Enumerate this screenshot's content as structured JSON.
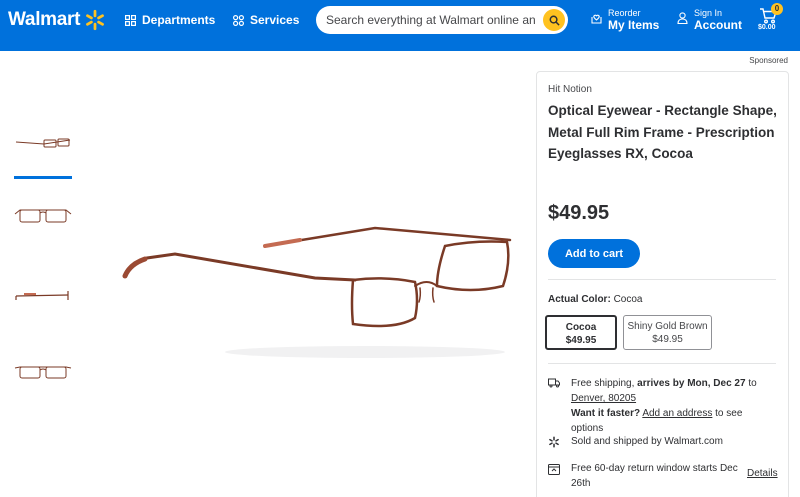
{
  "header": {
    "logo_text": "Walmart",
    "departments_label": "Departments",
    "services_label": "Services",
    "search_placeholder": "Search everything at Walmart online and in store",
    "reorder_small": "Reorder",
    "reorder_big": "My Items",
    "signin_small": "Sign In",
    "signin_big": "Account",
    "cart_count": "0",
    "cart_total": "$0.00"
  },
  "sponsored_label": "Sponsored",
  "thumbnails": [
    {
      "icon": "eyeglasses-side-view",
      "active": true
    },
    {
      "icon": "eyeglasses-front-view",
      "active": false
    },
    {
      "icon": "eyeglasses-temple-view",
      "active": false
    },
    {
      "icon": "eyeglasses-front-flat-view",
      "active": false
    }
  ],
  "product": {
    "brand": "Hit Notion",
    "title": "Optical Eyewear - Rectangle Shape, Metal Full Rim Frame - Prescription Eyeglasses RX, Cocoa",
    "price": "$49.95",
    "add_to_cart": "Add to cart",
    "actual_color_label": "Actual Color:",
    "actual_color_value": "Cocoa",
    "variants": [
      {
        "name": "Cocoa",
        "price": "$49.95",
        "selected": true
      },
      {
        "name": "Shiny Gold Brown",
        "price": "$49.95",
        "selected": false
      }
    ]
  },
  "fulfillment": {
    "shipping_prefix": "Free shipping, ",
    "shipping_arrives": "arrives by Mon, Dec 27",
    "shipping_to": " to",
    "location": "Denver, 80205",
    "faster_label": "Want it faster?",
    "add_address": "Add an address",
    "see_options": " to see options",
    "sold_by": "Sold and shipped by Walmart.com",
    "returns": "Free 60-day return window starts Dec 26th",
    "details": "Details"
  },
  "colors": {
    "brand_blue": "#0071dc",
    "spark_yellow": "#ffc220",
    "frame_brown": "#7a3a26"
  }
}
